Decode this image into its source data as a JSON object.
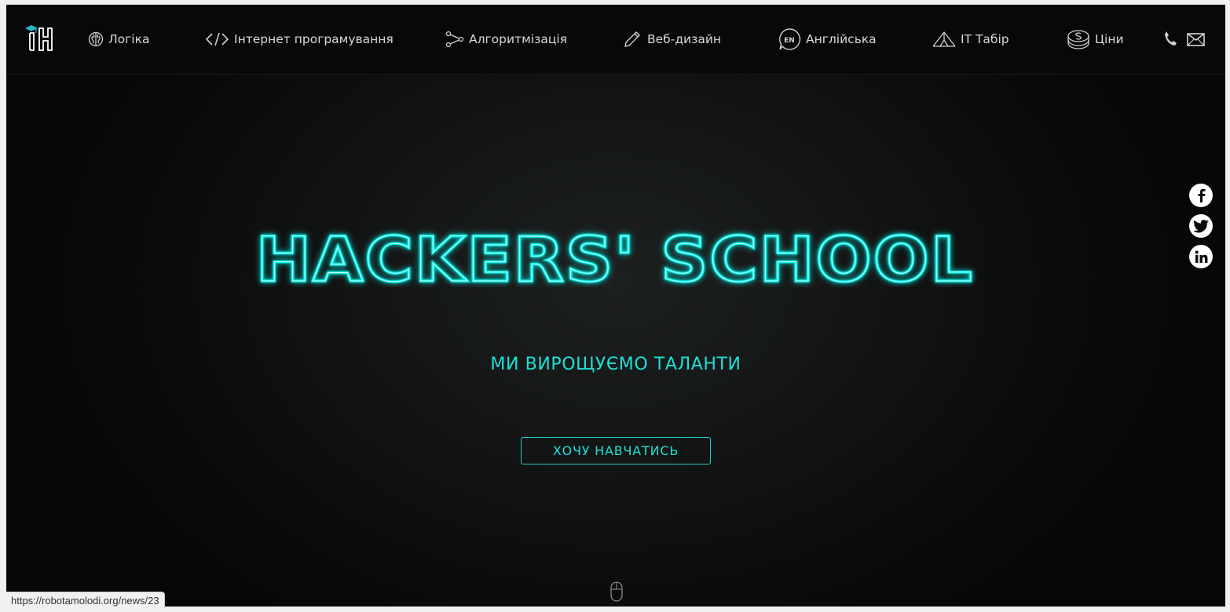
{
  "nav": {
    "logo_icon": "hackers-school-logo-icon",
    "items": [
      {
        "label": "Логіка",
        "icon": "brain-icon"
      },
      {
        "label": "Інтернет програмування",
        "icon": "code-icon"
      },
      {
        "label": "Алгоритмізація",
        "icon": "nodes-icon"
      },
      {
        "label": "Веб-дизайн",
        "icon": "pencil-icon"
      },
      {
        "label": "Англійська",
        "icon": "en-speech-icon",
        "icon_text": "EN"
      },
      {
        "label": "IT Табір",
        "icon": "tent-icon"
      },
      {
        "label": "Ціни",
        "icon": "coins-icon"
      }
    ],
    "contacts": [
      {
        "icon": "phone-icon"
      },
      {
        "icon": "mail-icon"
      }
    ]
  },
  "social": [
    {
      "icon": "facebook-icon"
    },
    {
      "icon": "twitter-icon"
    },
    {
      "icon": "linkedin-icon"
    }
  ],
  "hero": {
    "title": "HACKERS' SCHOOL",
    "tagline": "МИ ВИРОЩУЄМО ТАЛАНТИ",
    "cta_label": "ХОЧУ НАВЧАТИСЬ",
    "scroll_icon": "mouse-scroll-icon"
  },
  "status_bar": {
    "url": "https://robotamolodi.org/news/23"
  },
  "colors": {
    "accent": "#1fe0d6",
    "title_glow": "#00f0e6",
    "nav_bg": "#080808",
    "nav_text": "#d9d9d9",
    "page_bg": "#0c0d0d",
    "icon_white": "#ffffff"
  }
}
